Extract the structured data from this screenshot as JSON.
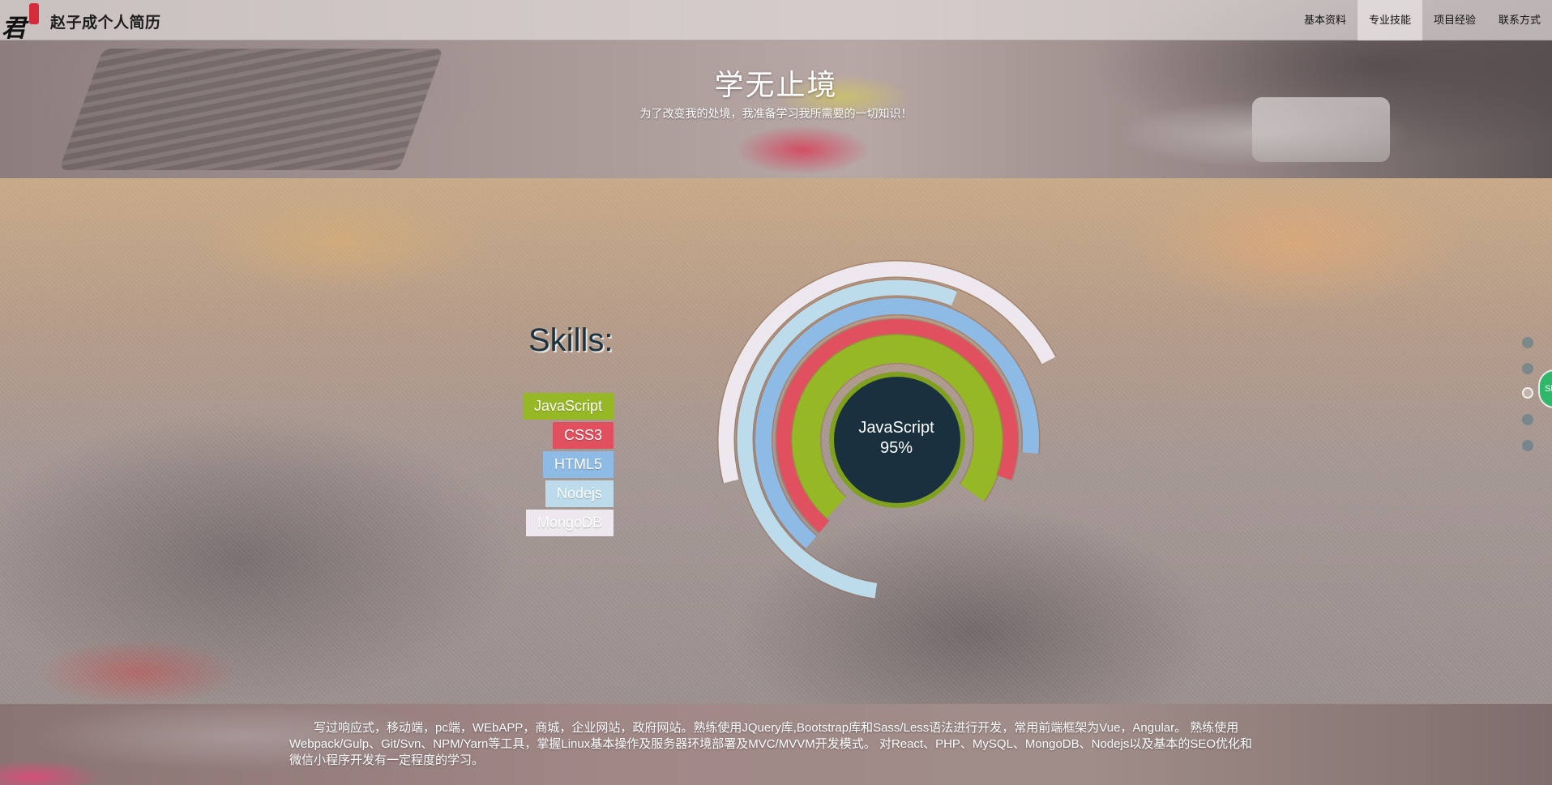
{
  "header": {
    "logo_icon": "calligraphy-jun-logo-icon",
    "site_title": "赵子成个人简历",
    "nav": [
      {
        "label": "基本资料",
        "active": false
      },
      {
        "label": "专业技能",
        "active": true
      },
      {
        "label": "项目经验",
        "active": false
      },
      {
        "label": "联系方式",
        "active": false
      }
    ]
  },
  "hero": {
    "title": "学无止境",
    "subtitle": "为了改变我的处境，我准备学习我所需要的一切知识！"
  },
  "skills": {
    "heading": "Skills:",
    "tags": [
      {
        "label": "JavaScript",
        "color": "#97b825"
      },
      {
        "label": "CSS3",
        "color": "#e0505f"
      },
      {
        "label": "HTML5",
        "color": "#8ebbe5"
      },
      {
        "label": "Nodejs",
        "color": "#bcdcec"
      },
      {
        "label": "MongoDB",
        "color": "#ede8ed"
      }
    ]
  },
  "chart_data": {
    "type": "radial-bar",
    "center_label": "JavaScript",
    "center_value": "95%",
    "series": [
      {
        "name": "JavaScript",
        "value": 95,
        "color": "#97b825"
      },
      {
        "name": "CSS3",
        "value": 90,
        "color": "#e0505f"
      },
      {
        "name": "HTML5",
        "value": 85,
        "color": "#8ebbe5"
      },
      {
        "name": "Nodejs",
        "value": 70,
        "color": "#bcdcec"
      },
      {
        "name": "MongoDB",
        "value": 60,
        "color": "#ede8ed"
      }
    ]
  },
  "side_nav": {
    "dots": [
      false,
      false,
      true,
      false,
      false
    ],
    "badge_text": "SE"
  },
  "description": "写过响应式，移动端，pc端，WEbAPP，商城，企业网站，政府网站。熟练使用JQuery库,Bootstrap库和Sass/Less语法进行开发，常用前端框架为Vue，Angular。 熟练使用Webpack/Gulp、Git/Svn、NPM/Yarn等工具，掌握Linux基本操作及服务器环境部署及MVC/MVVM开发模式。 对React、PHP、MySQL、MongoDB、Nodejs以及基本的SEO优化和微信小程序开发有一定程度的学习。"
}
